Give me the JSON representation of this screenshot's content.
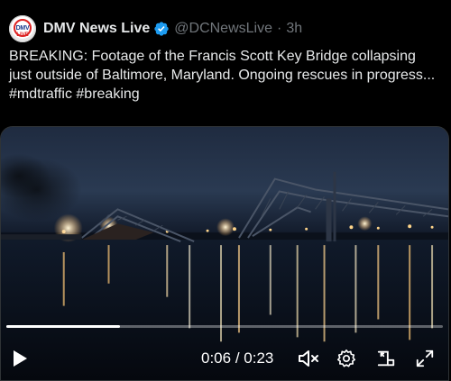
{
  "post": {
    "author_name": "DMV News Live",
    "handle": "@DCNewsLive",
    "separator": "·",
    "time": "3h",
    "avatar_text": "DMV",
    "avatar_subtext": "LIVE",
    "text": "BREAKING: Footage of the Francis Scott Key Bridge collapsing just outside of Baltimore, Maryland. Ongoing rescues in progress...",
    "hashtags": [
      "#mdtraffic",
      "#breaking"
    ],
    "verified_color": "#1d9bf0"
  },
  "video": {
    "current_time": "0:06",
    "duration": "0:23",
    "time_separator": " / ",
    "progress": 0.26,
    "icons": {
      "play": "play-icon",
      "mute": "volume-muted-icon",
      "settings": "gear-icon",
      "pip": "picture-in-picture-icon",
      "fullscreen": "fullscreen-icon"
    }
  }
}
